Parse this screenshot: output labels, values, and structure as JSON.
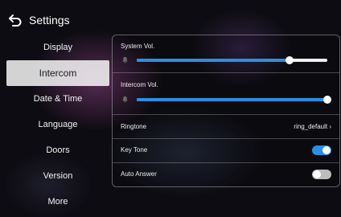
{
  "header": {
    "title": "Settings",
    "back_icon": "back-arrow-icon"
  },
  "sidebar": {
    "items": [
      {
        "label": "Display"
      },
      {
        "label": "Intercom"
      },
      {
        "label": "Date & Time"
      },
      {
        "label": "Language"
      },
      {
        "label": "Doors"
      },
      {
        "label": "Version"
      },
      {
        "label": "More"
      }
    ],
    "active": "Intercom"
  },
  "panel": {
    "system_vol": {
      "label": "System Vol.",
      "level": 0.8,
      "icon": "bell-icon"
    },
    "intercom_vol": {
      "label": "Intercom Vol.",
      "level": 1.0,
      "icon": "bell-icon"
    },
    "ringtone": {
      "label": "Ringtone",
      "value": "ring_default ›"
    },
    "key_tone": {
      "label": "Key Tone",
      "on": true
    },
    "auto_answer": {
      "label": "Auto Answer",
      "on": false
    }
  },
  "colors": {
    "accent": "#2a8fe0",
    "toggle_off": "#bdbdbd",
    "active_tab_bg": "#d9d9d9"
  }
}
